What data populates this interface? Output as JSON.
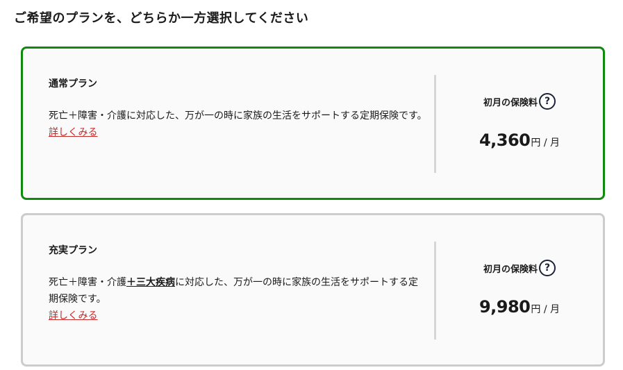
{
  "heading": "ご希望のプランを、どちらか一方選択してください",
  "plans": [
    {
      "name": "通常プラン",
      "desc_pre": "死亡＋障害・介護",
      "desc_em": "",
      "desc_post": "に対応した、万が一の時に家族の生活をサポートする定期保険です。",
      "link": "詳しくみる",
      "price_label": "初月の保険料",
      "help": "?",
      "price": "4,360",
      "unit": "円 / 月",
      "selected": true
    },
    {
      "name": "充実プラン",
      "desc_pre": "死亡＋障害・介護",
      "desc_em": "＋三大疾病",
      "desc_post": "に対応した、万が一の時に家族の生活をサポートする定期保険です。",
      "link": "詳しくみる",
      "price_label": "初月の保険料",
      "help": "?",
      "price": "9,980",
      "unit": "円 / 月",
      "selected": false
    }
  ],
  "colors": {
    "selected_border": "#0f8a0f",
    "default_border": "#cccccc",
    "link": "#c62828"
  }
}
